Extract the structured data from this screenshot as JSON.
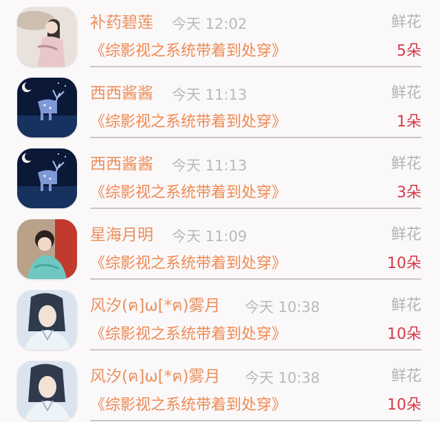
{
  "rows": [
    {
      "name": "补药碧莲",
      "time": "今天 12:02",
      "gift": "鲜花",
      "book": "《综影视之系统带着到处穿》",
      "count": "5朵",
      "avatar": "woman-umbrella-avatar"
    },
    {
      "name": "西西酱酱",
      "time": "今天 11:13",
      "gift": "鲜花",
      "book": "《综影视之系统带着到处穿》",
      "count": "1朵",
      "avatar": "star-deer-avatar"
    },
    {
      "name": "西西酱酱",
      "time": "今天 11:13",
      "gift": "鲜花",
      "book": "《综影视之系统带着到处穿》",
      "count": "3朵",
      "avatar": "star-deer-avatar"
    },
    {
      "name": "星海月明",
      "time": "今天 11:09",
      "gift": "鲜花",
      "book": "《综影视之系统带着到处穿》",
      "count": "10朵",
      "avatar": "costume-girl-avatar"
    },
    {
      "name": "风汐(ฅ]ω[*ฅ)雾月",
      "time": "今天 10:38",
      "gift": "鲜花",
      "book": "《综影视之系统带着到处穿》",
      "count": "10朵",
      "avatar": "costume-man-avatar"
    },
    {
      "name": "风汐(ฅ]ω[*ฅ)雾月",
      "time": "今天 10:38",
      "gift": "鲜花",
      "book": "《综影视之系统带着到处穿》",
      "count": "10朵",
      "avatar": "costume-man-avatar"
    }
  ],
  "colors": {
    "name": "#e9905c",
    "book": "#ee8a52",
    "count": "#d33a45",
    "meta": "#b9b9b9"
  }
}
